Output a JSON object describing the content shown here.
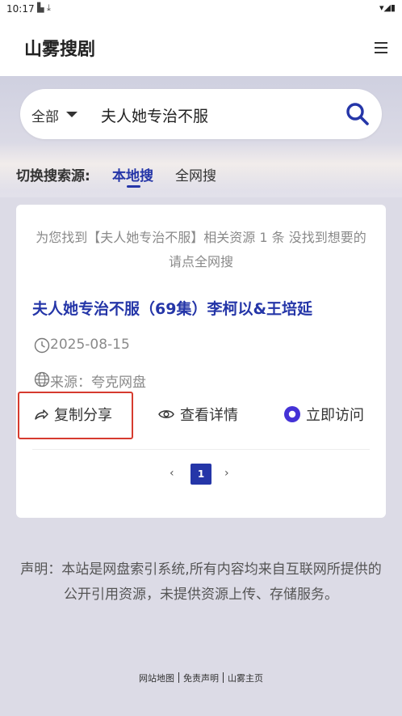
{
  "status_bar": {
    "time": "10:17",
    "left_icons": "▙ ⤓",
    "right_icons": "▾◢▮"
  },
  "header": {
    "site_title": "山雾搜剧"
  },
  "search": {
    "scope": "全部",
    "query": "夫人她专治不服"
  },
  "source_switch": {
    "label": "切换搜索源:",
    "tabs": [
      "本地搜",
      "全网搜"
    ],
    "active": "本地搜"
  },
  "results": {
    "message": "为您找到【夫人她专治不服】相关资源 1 条 没找到想要的请点全网搜",
    "items": [
      {
        "title": "夫人她专治不服（69集）李柯以&王培延",
        "date": "2025-08-15",
        "source": "来源：夸克网盘",
        "actions": {
          "copy": "复制分享",
          "details": "查看详情",
          "visit": "立即访问"
        }
      }
    ]
  },
  "pagination": {
    "prev": "‹",
    "current": "1",
    "next": "›"
  },
  "disclaimer": "声明：本站是网盘索引系统,所有内容均来自互联网所提供的公开引用资源，未提供资源上传、存储服务。",
  "footer": {
    "links": [
      "网站地图",
      "免责声明",
      "山雾主页"
    ]
  },
  "colors": {
    "accent": "#2536a8",
    "highlight_box": "#d63b2f",
    "background": "#dcdbe6"
  },
  "icons": {
    "search": "search-icon",
    "menu": "menu-icon",
    "clock": "clock-icon",
    "globe": "globe-icon",
    "share": "share-arrow-icon",
    "eye": "eye-icon",
    "visit": "target-circle-icon"
  }
}
